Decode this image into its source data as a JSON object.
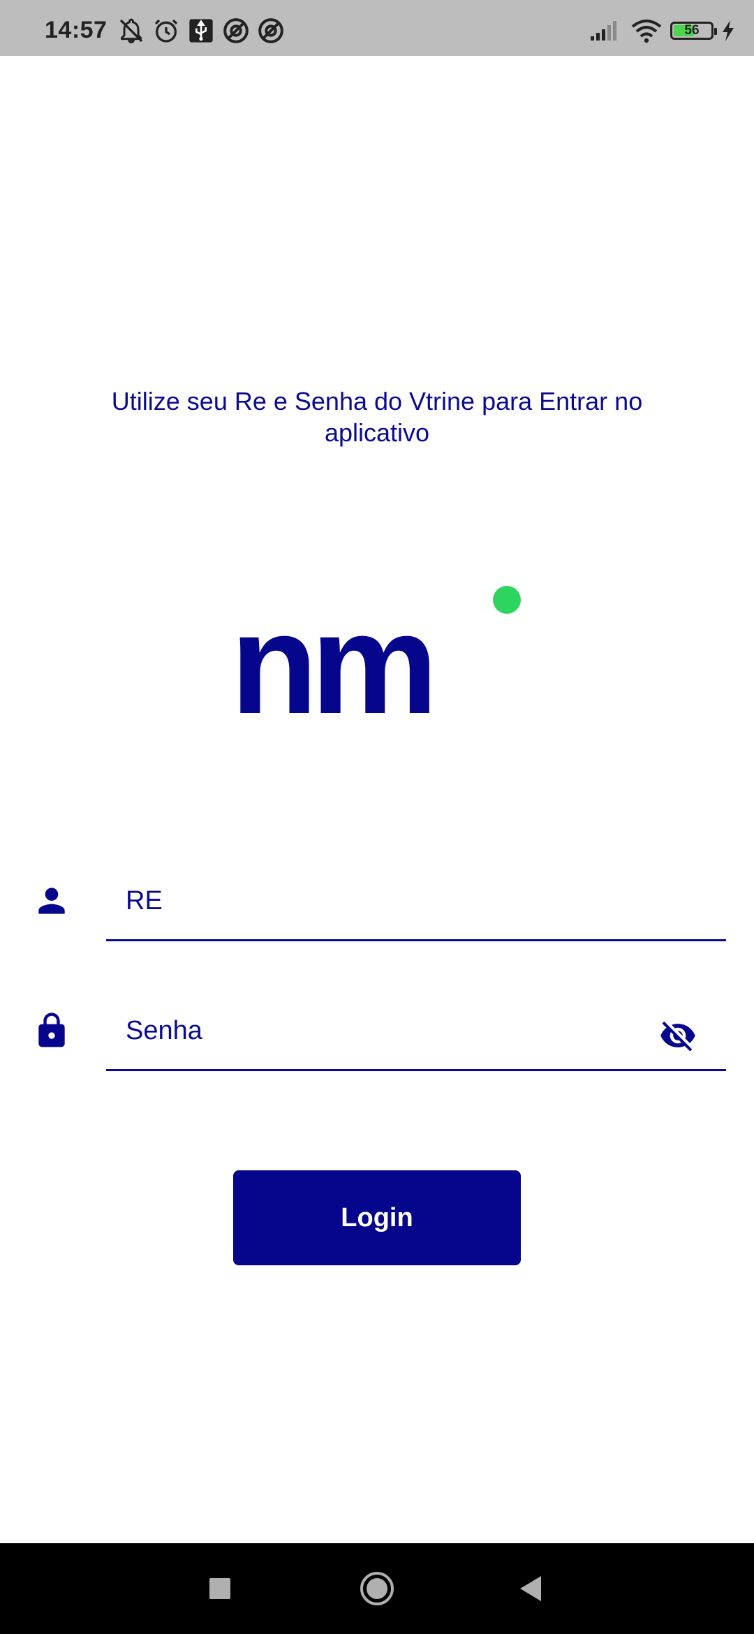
{
  "status_bar": {
    "time": "14:57",
    "left_icons": [
      "notifications-off-icon",
      "alarm-icon",
      "usb-icon",
      "app-notification-icon",
      "app-notification-icon"
    ],
    "right_icons": [
      "signal-icon",
      "wifi-icon",
      "battery-icon",
      "charging-icon"
    ],
    "battery_level": "56",
    "battery_fraction": 0.56,
    "battery_color": "#4cd44c"
  },
  "instruction": "Utilize seu Re e Senha do Vtrine para Entrar no aplicativo",
  "logo": {
    "text": "nm",
    "brand_color": "#06068c",
    "dot_color": "#2ed460"
  },
  "form": {
    "re": {
      "placeholder": "RE",
      "value": "",
      "icon": "person-icon"
    },
    "senha": {
      "placeholder": "Senha",
      "value": "",
      "icon": "lock-icon",
      "toggle_icon": "visibility-off-icon"
    },
    "login_label": "Login"
  },
  "nav_bar": {
    "icons": [
      "recents-icon",
      "home-icon",
      "back-icon"
    ]
  },
  "colors": {
    "primary": "#06068c",
    "text": "#0b0b8f",
    "status_bar_bg": "#bdbdbd",
    "nav_bar_bg": "#000000"
  }
}
